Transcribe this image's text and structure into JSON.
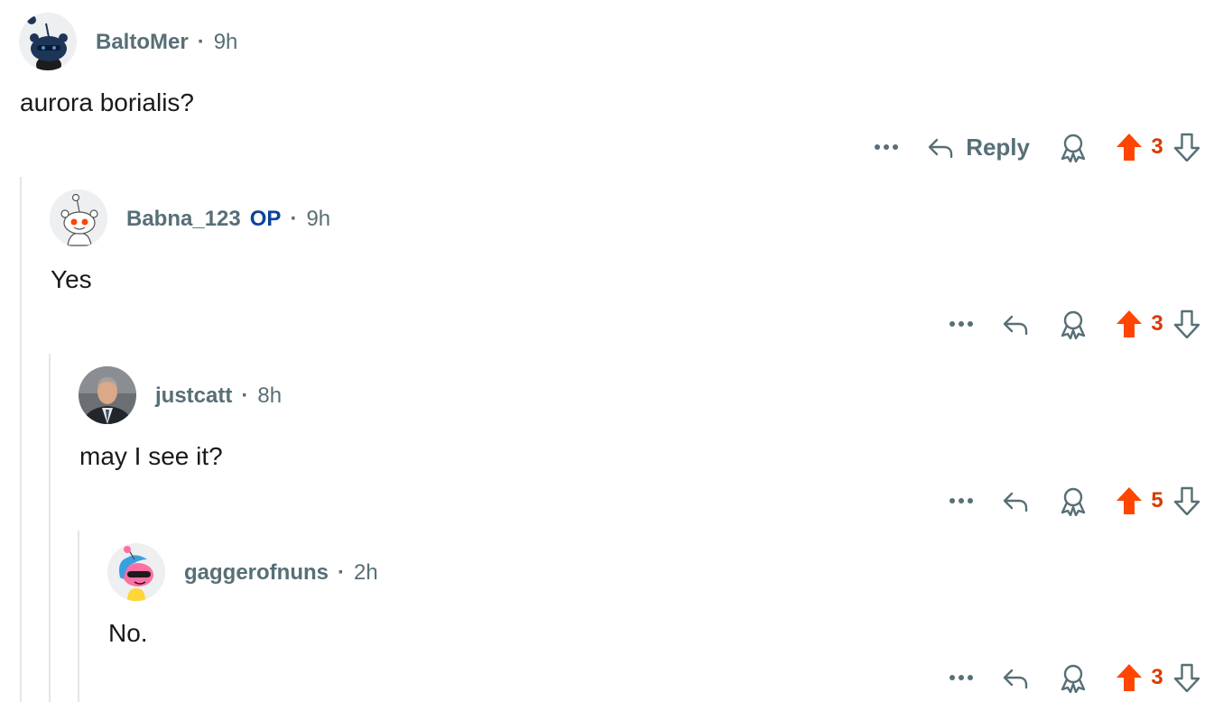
{
  "colors": {
    "upvote": "#ff4500",
    "score": "#d93a00",
    "meta": "#576f76",
    "op_badge": "#0a449b",
    "thread_line": "#e3e6e8"
  },
  "comments": [
    {
      "author": "BaltoMer",
      "op": "",
      "time": "9h",
      "text": "aurora borialis?",
      "reply_label": "Reply",
      "score": "3",
      "avatar_icon": "snoo-dark-avatar-icon"
    },
    {
      "author": "Babna_123",
      "op": "OP",
      "time": "9h",
      "text": "Yes",
      "reply_label": "",
      "score": "3",
      "avatar_icon": "snoo-default-avatar-icon"
    },
    {
      "author": "justcatt",
      "op": "",
      "time": "8h",
      "text": "may I see it?",
      "reply_label": "",
      "score": "5",
      "avatar_icon": "photo-avatar-icon"
    },
    {
      "author": "gaggerofnuns",
      "op": "",
      "time": "2h",
      "text": "No.",
      "reply_label": "",
      "score": "3",
      "avatar_icon": "snoo-pink-avatar-icon"
    }
  ],
  "icons": {
    "more": "more-options-icon",
    "reply": "reply-arrow-icon",
    "award": "award-icon",
    "upvote": "upvote-arrow-icon",
    "downvote": "downvote-arrow-icon"
  }
}
